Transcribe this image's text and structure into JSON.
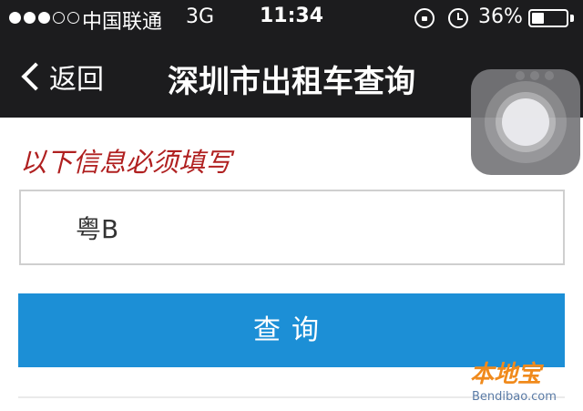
{
  "status_bar": {
    "signal_dots_filled": 3,
    "signal_dots_total": 5,
    "carrier": "中国联通",
    "network": "3G",
    "time": "11:34",
    "battery_percent_text": "36%",
    "battery_level": 0.36,
    "icons": [
      "rotation-lock-icon",
      "alarm-icon",
      "battery-icon"
    ]
  },
  "nav": {
    "back_label": "返回",
    "title": "深圳市出租车查询",
    "more_icon": "more-dots-icon"
  },
  "form": {
    "required_note": "以下信息必须填写",
    "plate_value": "粤B",
    "submit_label": "查询"
  },
  "watermark": {
    "logo": "本地宝",
    "url": "Bendibao.com"
  },
  "colors": {
    "bar_bg": "#1c1c1e",
    "accent_button": "#1c8fd6",
    "note_red": "#b02020",
    "watermark_orange": "#f08a1c"
  }
}
